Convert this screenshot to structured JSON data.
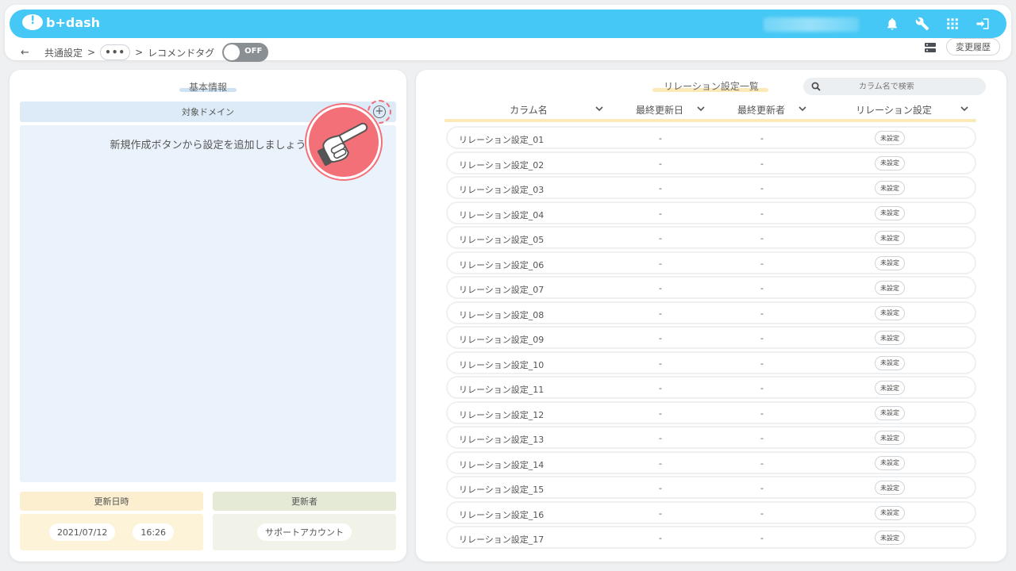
{
  "app": {
    "logo_text": "b+dash"
  },
  "breadcrumb": {
    "back_label": "←",
    "root": "共通設定",
    "sep": ">",
    "ellipsis": "•••",
    "current": "レコメンドタグ"
  },
  "toggle": {
    "state_label": "OFF"
  },
  "header_actions": {
    "history_label": "変更履歴"
  },
  "left_panel": {
    "title": "基本情報",
    "domain_header": "対象ドメイン",
    "empty_message": "新規作成ボタンから設定を追加しましょう",
    "add_symbol": "+",
    "updated_at_label": "更新日時",
    "updated_by_label": "更新者",
    "updated_date": "2021/07/12",
    "updated_time": "16:26",
    "updated_by": "サポートアカウント"
  },
  "right_panel": {
    "title": "リレーション設定一覧",
    "search_placeholder": "カラム名で検索",
    "columns": [
      "カラム名",
      "最終更新日",
      "最終更新者",
      "リレーション設定"
    ],
    "rows": [
      {
        "name": "リレーション設定_01",
        "date": "-",
        "user": "-",
        "status": "未設定"
      },
      {
        "name": "リレーション設定_02",
        "date": "-",
        "user": "-",
        "status": "未設定"
      },
      {
        "name": "リレーション設定_03",
        "date": "-",
        "user": "-",
        "status": "未設定"
      },
      {
        "name": "リレーション設定_04",
        "date": "-",
        "user": "-",
        "status": "未設定"
      },
      {
        "name": "リレーション設定_05",
        "date": "-",
        "user": "-",
        "status": "未設定"
      },
      {
        "name": "リレーション設定_06",
        "date": "-",
        "user": "-",
        "status": "未設定"
      },
      {
        "name": "リレーション設定_07",
        "date": "-",
        "user": "-",
        "status": "未設定"
      },
      {
        "name": "リレーション設定_08",
        "date": "-",
        "user": "-",
        "status": "未設定"
      },
      {
        "name": "リレーション設定_09",
        "date": "-",
        "user": "-",
        "status": "未設定"
      },
      {
        "name": "リレーション設定_10",
        "date": "-",
        "user": "-",
        "status": "未設定"
      },
      {
        "name": "リレーション設定_11",
        "date": "-",
        "user": "-",
        "status": "未設定"
      },
      {
        "name": "リレーション設定_12",
        "date": "-",
        "user": "-",
        "status": "未設定"
      },
      {
        "name": "リレーション設定_13",
        "date": "-",
        "user": "-",
        "status": "未設定"
      },
      {
        "name": "リレーション設定_14",
        "date": "-",
        "user": "-",
        "status": "未設定"
      },
      {
        "name": "リレーション設定_15",
        "date": "-",
        "user": "-",
        "status": "未設定"
      },
      {
        "name": "リレーション設定_16",
        "date": "-",
        "user": "-",
        "status": "未設定"
      },
      {
        "name": "リレーション設定_17",
        "date": "-",
        "user": "-",
        "status": "未設定"
      }
    ]
  },
  "colors": {
    "brand": "#45c8f5",
    "highlight": "#f37079",
    "domain_bg": "#eaf2fb",
    "date_bg": "#fcf3d9",
    "user_bg": "#e9eedd"
  },
  "icons": [
    "bell-icon",
    "wrench-icon",
    "grid-icon",
    "logout-icon",
    "server-icon",
    "search-icon",
    "chevron-down-icon",
    "pointing-hand-icon"
  ]
}
